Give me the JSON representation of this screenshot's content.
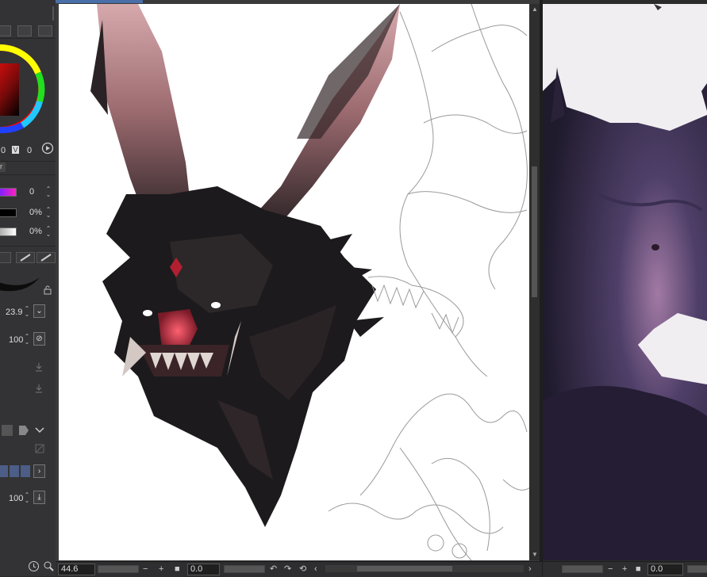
{
  "color": {
    "value_left": "0",
    "value_right": "0",
    "value_badge": "V"
  },
  "color_sliders": {
    "slider1_value": "0",
    "slider2_value": "0%",
    "slider3_value": "0%"
  },
  "tool_property": {
    "brush_size": "23.9",
    "opacity": "100",
    "density": "100"
  },
  "canvas_main": {
    "zoom": "44.6",
    "rotation": "0.0"
  },
  "canvas_secondary": {
    "rotation": "0.0"
  },
  "icons": [
    "color-wheel-icon",
    "play-circle-icon",
    "lock-icon",
    "chevron-down-icon",
    "chevron-right-icon",
    "download-icon",
    "undo-icon",
    "redo-icon",
    "rotate-icon",
    "zoom-out-icon",
    "zoom-in-icon",
    "fit-icon"
  ]
}
